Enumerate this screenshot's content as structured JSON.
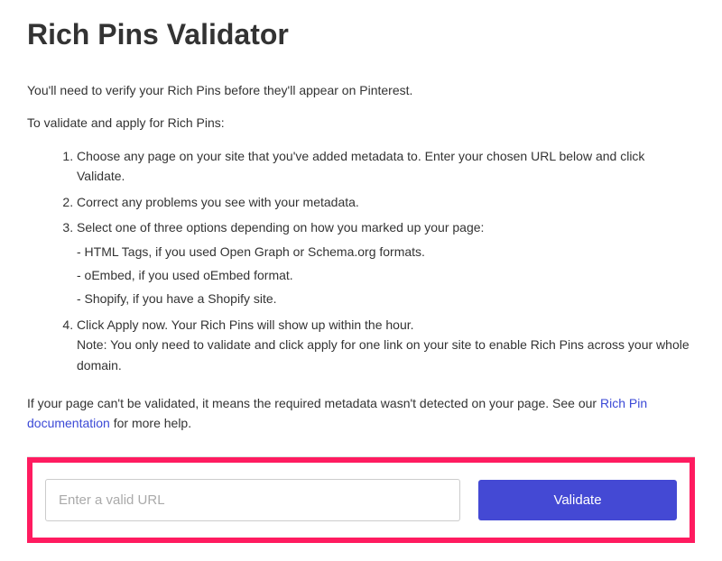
{
  "title": "Rich Pins Validator",
  "intro": "You'll need to verify your Rich Pins before they'll appear on Pinterest.",
  "instructions_label": "To validate and apply for Rich Pins:",
  "steps": {
    "s1": "Choose any page on your site that you've added metadata to. Enter your chosen URL below and click Validate.",
    "s2": "Correct any problems you see with your metadata.",
    "s3": "Select one of three options depending on how you marked up your page:",
    "s3_sub": {
      "a": "- HTML Tags, if you used Open Graph or Schema.org formats.",
      "b": "- oEmbed, if you used oEmbed format.",
      "c": "- Shopify, if you have a Shopify site."
    },
    "s4": "Click Apply now. Your Rich Pins will show up within the hour.",
    "s4_note": "Note: You only need to validate and click apply for one link on your site to enable Rich Pins across your whole domain."
  },
  "help": {
    "prefix": "If your page can't be validated, it means the required metadata wasn't detected on your page. See our ",
    "link_text": "Rich Pin documentation",
    "suffix": " for more help."
  },
  "form": {
    "url_placeholder": "Enter a valid URL",
    "url_value": "",
    "validate_label": "Validate"
  }
}
